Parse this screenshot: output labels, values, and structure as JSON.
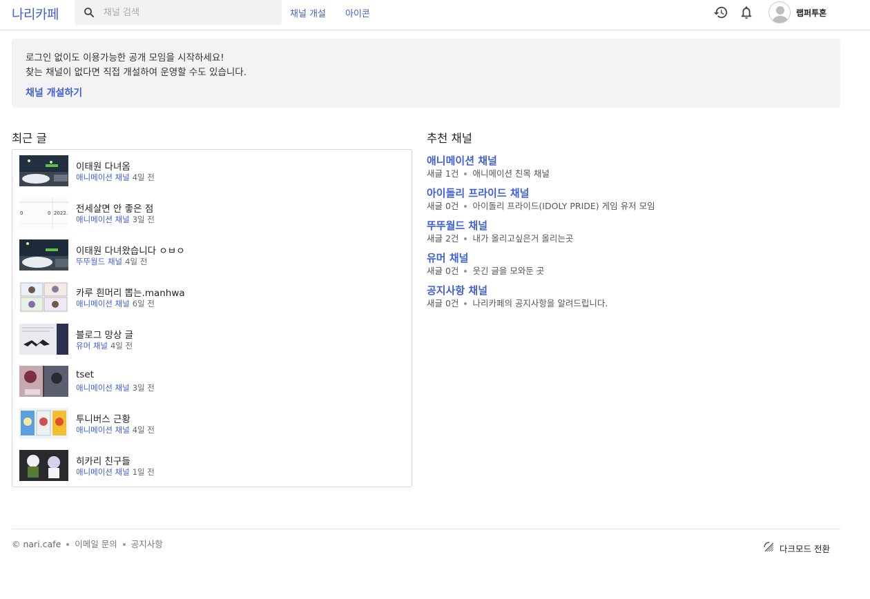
{
  "header": {
    "logo": "나리카페",
    "search_placeholder": "채널 검색",
    "nav": [
      "채널 개설",
      "아이콘"
    ],
    "username": "랩퍼투혼",
    "icons": [
      "search-icon",
      "history-icon",
      "bell-icon",
      "avatar-icon"
    ]
  },
  "notice": {
    "line1": "로그인 없이도 이용가능한 공개 모임을 시작하세요!",
    "line2": "찾는 채널이 없다면 직접 개설하여 운영할 수도 있습니다.",
    "cta": "채널 개설하기"
  },
  "recent": {
    "title": "최근 글",
    "posts": [
      {
        "title": "이태원 다녀옴",
        "channel": "애니메이션 채널",
        "time": "4일 전"
      },
      {
        "title": "전세살면 안 좋은 점",
        "channel": "애니메이션 채널",
        "time": "3일 전"
      },
      {
        "title": "이태원 다녀왔습니다 ㅇㅂㅇ",
        "channel": "뚜뚜월드 채널",
        "time": "4일 전"
      },
      {
        "title": "카루 흰머리 뽑는.manhwa",
        "channel": "애니메이션 채널",
        "time": "6일 전"
      },
      {
        "title": "블로그 망상 글",
        "channel": "유머 채널",
        "time": "4일 전"
      },
      {
        "title": "tset",
        "channel": "애니메이션 채널",
        "time": "3일 전"
      },
      {
        "title": "투니버스 근황",
        "channel": "애니메이션 채널",
        "time": "4일 전"
      },
      {
        "title": "히카리 친구들",
        "channel": "애니메이션 채널",
        "time": "1일 전"
      }
    ]
  },
  "recommended": {
    "title": "추천 채널",
    "channels": [
      {
        "name": "애니메이션 채널",
        "count": "새글 1건",
        "desc": "애니메이션 친목 채널"
      },
      {
        "name": "아이돌리 프라이드 채널",
        "count": "새글 0건",
        "desc": "아이돌리 프라이드(IDOLY PRIDE) 게임 유저 모임"
      },
      {
        "name": "뚜뚜월드 채널",
        "count": "새글 2건",
        "desc": "내가 올리고싶은거 올리는곳"
      },
      {
        "name": "유머 채널",
        "count": "새글 0건",
        "desc": "웃긴 글을 모와둔 곳"
      },
      {
        "name": "공지사항 채널",
        "count": "새글 0건",
        "desc": "나리카페의 공지사항을 알려드립니다."
      }
    ]
  },
  "footer": {
    "copyright": "© nari.cafe",
    "links": [
      "이메일 문의",
      "공지사항"
    ],
    "dark_mode": "다크모드 전환"
  },
  "colors": {
    "accent": "#3f5fd6",
    "notice_bg": "#f3f3f3"
  }
}
